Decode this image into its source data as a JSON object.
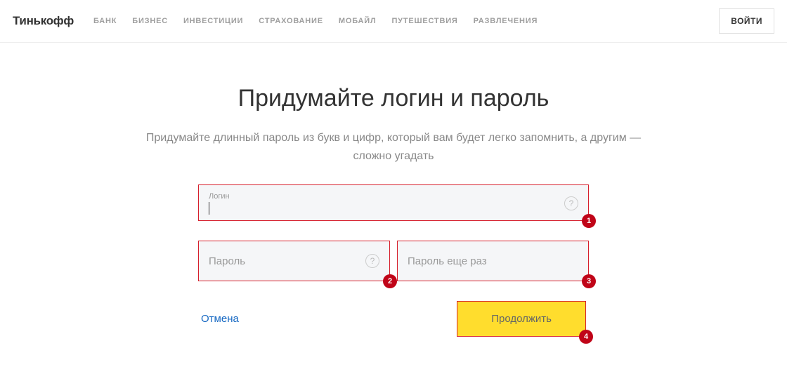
{
  "header": {
    "logo": "Тинькофф",
    "nav": [
      "БАНК",
      "БИЗНЕС",
      "ИНВЕСТИЦИИ",
      "СТРАХОВАНИЕ",
      "МОБАЙЛ",
      "ПУТЕШЕСТВИЯ",
      "РАЗВЛЕЧЕНИЯ"
    ],
    "login_button": "ВОЙТИ"
  },
  "main": {
    "title": "Придумайте логин и пароль",
    "subtitle": "Придумайте длинный пароль из букв и цифр, который вам будет легко запомнить, а другим — сложно угадать"
  },
  "form": {
    "login": {
      "label": "Логин",
      "value": ""
    },
    "password": {
      "placeholder": "Пароль"
    },
    "password_confirm": {
      "placeholder": "Пароль еще раз"
    },
    "cancel": "Отмена",
    "continue": "Продолжить"
  },
  "badges": {
    "b1": "1",
    "b2": "2",
    "b3": "3",
    "b4": "4"
  }
}
